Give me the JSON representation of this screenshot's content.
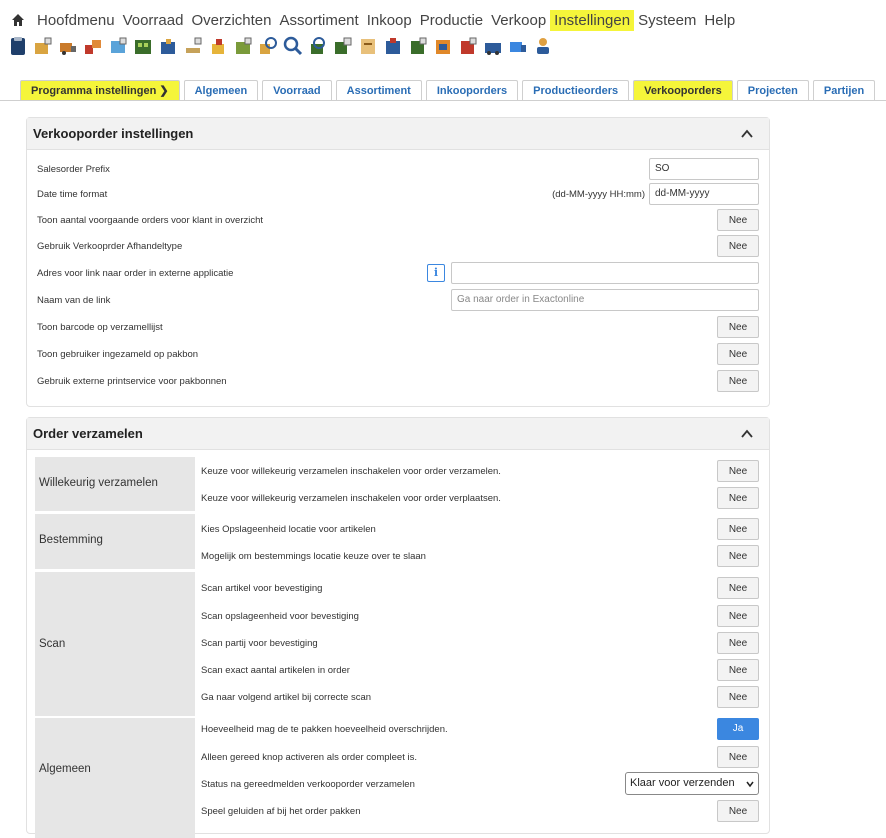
{
  "menubar": {
    "items": [
      "Hoofdmenu",
      "Voorraad",
      "Overzichten",
      "Assortiment",
      "Inkoop",
      "Productie",
      "Verkoop",
      "Instellingen",
      "Systeem",
      "Help"
    ],
    "highlighted": "Instellingen"
  },
  "toolbar": {
    "icons": [
      "clipboard-icon",
      "box-icon",
      "truck-icon",
      "boxes-icon",
      "cart-icon",
      "warehouse-icon",
      "package-icon",
      "forklift-icon",
      "stack-icon",
      "location-icon",
      "search-package-icon",
      "search-icon",
      "search-box-icon",
      "order-icon",
      "invoice-icon",
      "transfer-icon",
      "receipt-icon",
      "return-icon",
      "shipment-icon",
      "delivery-icon",
      "truck-blue-icon",
      "person-icon"
    ]
  },
  "tabs": [
    {
      "label": "Programma instellingen ❯",
      "highlighted": true
    },
    {
      "label": "Algemeen"
    },
    {
      "label": "Voorraad"
    },
    {
      "label": "Assortiment"
    },
    {
      "label": "Inkooporders"
    },
    {
      "label": "Productieorders"
    },
    {
      "label": "Verkooporders",
      "highlighted": true
    },
    {
      "label": "Projecten"
    },
    {
      "label": "Partijen"
    }
  ],
  "verkooporder": {
    "title": "Verkooporder instellingen",
    "rows": {
      "prefix_label": "Salesorder Prefix",
      "prefix_value": "SO",
      "datetime_label": "Date time format",
      "datetime_hint": "(dd-MM-yyyy HH:mm)",
      "datetime_value": "dd-MM-yyyy",
      "voorgaande_label": "Toon aantal voorgaande orders voor klant in overzicht",
      "voorgaande_value": "Nee",
      "afhandeltype_label": "Gebruik Verkooprder Afhandeltype",
      "afhandeltype_value": "Nee",
      "adres_label": "Adres voor link naar order in externe applicatie",
      "adres_value": "",
      "linknaam_label": "Naam van de link",
      "linknaam_placeholder": "Ga naar order in Exactonline",
      "barcode_label": "Toon barcode op verzamellijst",
      "barcode_value": "Nee",
      "gebruiker_label": "Toon gebruiker ingezameld op pakbon",
      "gebruiker_value": "Nee",
      "printservice_label": "Gebruik externe printservice voor pakbonnen",
      "printservice_value": "Nee"
    }
  },
  "verzamelen": {
    "title": "Order verzamelen",
    "groups": {
      "willekeurig": "Willekeurig verzamelen",
      "bestemming": "Bestemming",
      "scan": "Scan",
      "algemeen": "Algemeen"
    },
    "rows": [
      {
        "label": "Keuze voor willekeurig verzamelen inschakelen voor order verzamelen.",
        "value": "Nee"
      },
      {
        "label": "Keuze voor willekeurig verzamelen inschakelen voor order verplaatsen.",
        "value": "Nee"
      },
      {
        "label": "Kies Opslageenheid locatie voor artikelen",
        "value": "Nee"
      },
      {
        "label": "Mogelijk om bestemmings locatie keuze over te slaan",
        "value": "Nee"
      },
      {
        "label": "Scan artikel voor bevestiging",
        "value": "Nee"
      },
      {
        "label": "Scan opslageenheid voor bevestiging",
        "value": "Nee"
      },
      {
        "label": "Scan partij voor bevestiging",
        "value": "Nee"
      },
      {
        "label": "Scan exact aantal artikelen in order",
        "value": "Nee"
      },
      {
        "label": "Ga naar volgend artikel bij correcte scan",
        "value": "Nee"
      },
      {
        "label": "Hoeveelheid mag de te pakken hoeveelheid overschrijden.",
        "value": "Ja"
      },
      {
        "label": "Alleen gereed knop activeren als order compleet is.",
        "value": "Nee"
      },
      {
        "label": "Status na gereedmelden verkooporder verzamelen",
        "value": "Klaar voor verzenden"
      },
      {
        "label": "Speel geluiden af bij het order pakken",
        "value": "Nee"
      }
    ]
  },
  "colors": {
    "highlight": "#f5f53a",
    "link": "#2a6db5",
    "primary": "#3b87e0"
  }
}
